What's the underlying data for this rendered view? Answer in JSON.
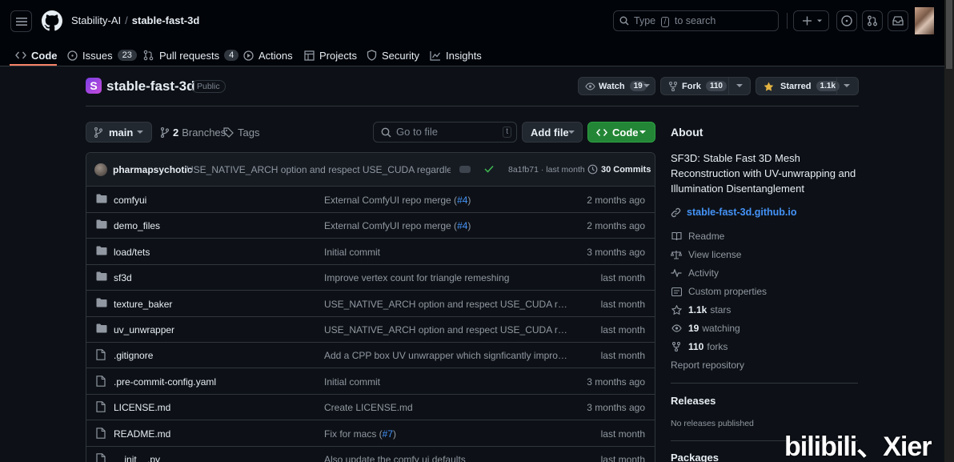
{
  "header": {
    "owner": "Stability-AI",
    "separator": "/",
    "repo": "stable-fast-3d",
    "search_placeholder_pre": "Type",
    "search_key": "/",
    "search_placeholder_post": "to search"
  },
  "nav": [
    {
      "label": "Code",
      "count": null,
      "icon": "code-icon"
    },
    {
      "label": "Issues",
      "count": "23",
      "icon": "issue-icon"
    },
    {
      "label": "Pull requests",
      "count": "4",
      "icon": "pull-request-icon"
    },
    {
      "label": "Actions",
      "count": null,
      "icon": "play-icon"
    },
    {
      "label": "Projects",
      "count": null,
      "icon": "table-icon"
    },
    {
      "label": "Security",
      "count": null,
      "icon": "shield-icon"
    },
    {
      "label": "Insights",
      "count": null,
      "icon": "graph-icon"
    }
  ],
  "repo": {
    "icon_letter": "S",
    "name": "stable-fast-3d",
    "visibility": "Public",
    "watch_label": "Watch",
    "watch_count": "19",
    "fork_label": "Fork",
    "fork_count": "110",
    "star_label": "Starred",
    "star_count": "1.1k"
  },
  "toolbar": {
    "branch": "main",
    "branches_count": "2",
    "branches_label": "Branches",
    "tags_label": "Tags",
    "goto_placeholder": "Go to file",
    "goto_key": "t",
    "add_file": "Add file",
    "code": "Code"
  },
  "commit": {
    "author": "pharmapsychotic",
    "message": "USE_NATIVE_ARCH option and respect USE_CUDA regardless of t...",
    "hash_time": "8a1fb71 · last month",
    "commits_count": "30",
    "commits_label": "Commits"
  },
  "files": [
    {
      "type": "dir",
      "name": "comfyui",
      "msg": "External ComfyUI repo merge (",
      "link": "#4",
      "msg_end": ")",
      "date": "2 months ago"
    },
    {
      "type": "dir",
      "name": "demo_files",
      "msg": "External ComfyUI repo merge (",
      "link": "#4",
      "msg_end": ")",
      "date": "2 months ago"
    },
    {
      "type": "dir",
      "name": "load/tets",
      "msg": "Initial commit",
      "link": "",
      "msg_end": "",
      "date": "3 months ago"
    },
    {
      "type": "dir",
      "name": "sf3d",
      "msg": "Improve vertex count for triangle remeshing",
      "link": "",
      "msg_end": "",
      "date": "last month"
    },
    {
      "type": "dir",
      "name": "texture_baker",
      "msg": "USE_NATIVE_ARCH option and respect USE_CUDA regardles...",
      "link": "",
      "msg_end": "",
      "date": "last month"
    },
    {
      "type": "dir",
      "name": "uv_unwrapper",
      "msg": "USE_NATIVE_ARCH option and respect USE_CUDA regardles...",
      "link": "",
      "msg_end": "",
      "date": "last month"
    },
    {
      "type": "file",
      "name": ".gitignore",
      "msg": "Add a CPP box UV unwrapper which signficantly improves in...",
      "link": "",
      "msg_end": "",
      "date": "last month"
    },
    {
      "type": "file",
      "name": ".pre-commit-config.yaml",
      "msg": "Initial commit",
      "link": "",
      "msg_end": "",
      "date": "3 months ago"
    },
    {
      "type": "file",
      "name": "LICENSE.md",
      "msg": "Create LICENSE.md",
      "link": "",
      "msg_end": "",
      "date": "3 months ago"
    },
    {
      "type": "file",
      "name": "README.md",
      "msg": "Fix for macs (",
      "link": "#7",
      "msg_end": ")",
      "date": "last month"
    },
    {
      "type": "file",
      "name": "__init__.py",
      "msg": "Also update the comfy ui defaults",
      "link": "",
      "msg_end": "",
      "date": "last month"
    }
  ],
  "about": {
    "heading": "About",
    "description": "SF3D: Stable Fast 3D Mesh Reconstruction with UV-unwrapping and Illumination Disentanglement",
    "homepage": "stable-fast-3d.github.io",
    "readme": "Readme",
    "license": "View license",
    "activity": "Activity",
    "custom_props": "Custom properties",
    "stars_num": "1.1k",
    "stars_label": "stars",
    "watching_num": "19",
    "watching_label": "watching",
    "forks_num": "110",
    "forks_label": "forks",
    "report": "Report repository"
  },
  "releases": {
    "heading": "Releases",
    "empty": "No releases published"
  },
  "packages": {
    "heading": "Packages"
  },
  "watermark": "bilibili、Xier"
}
